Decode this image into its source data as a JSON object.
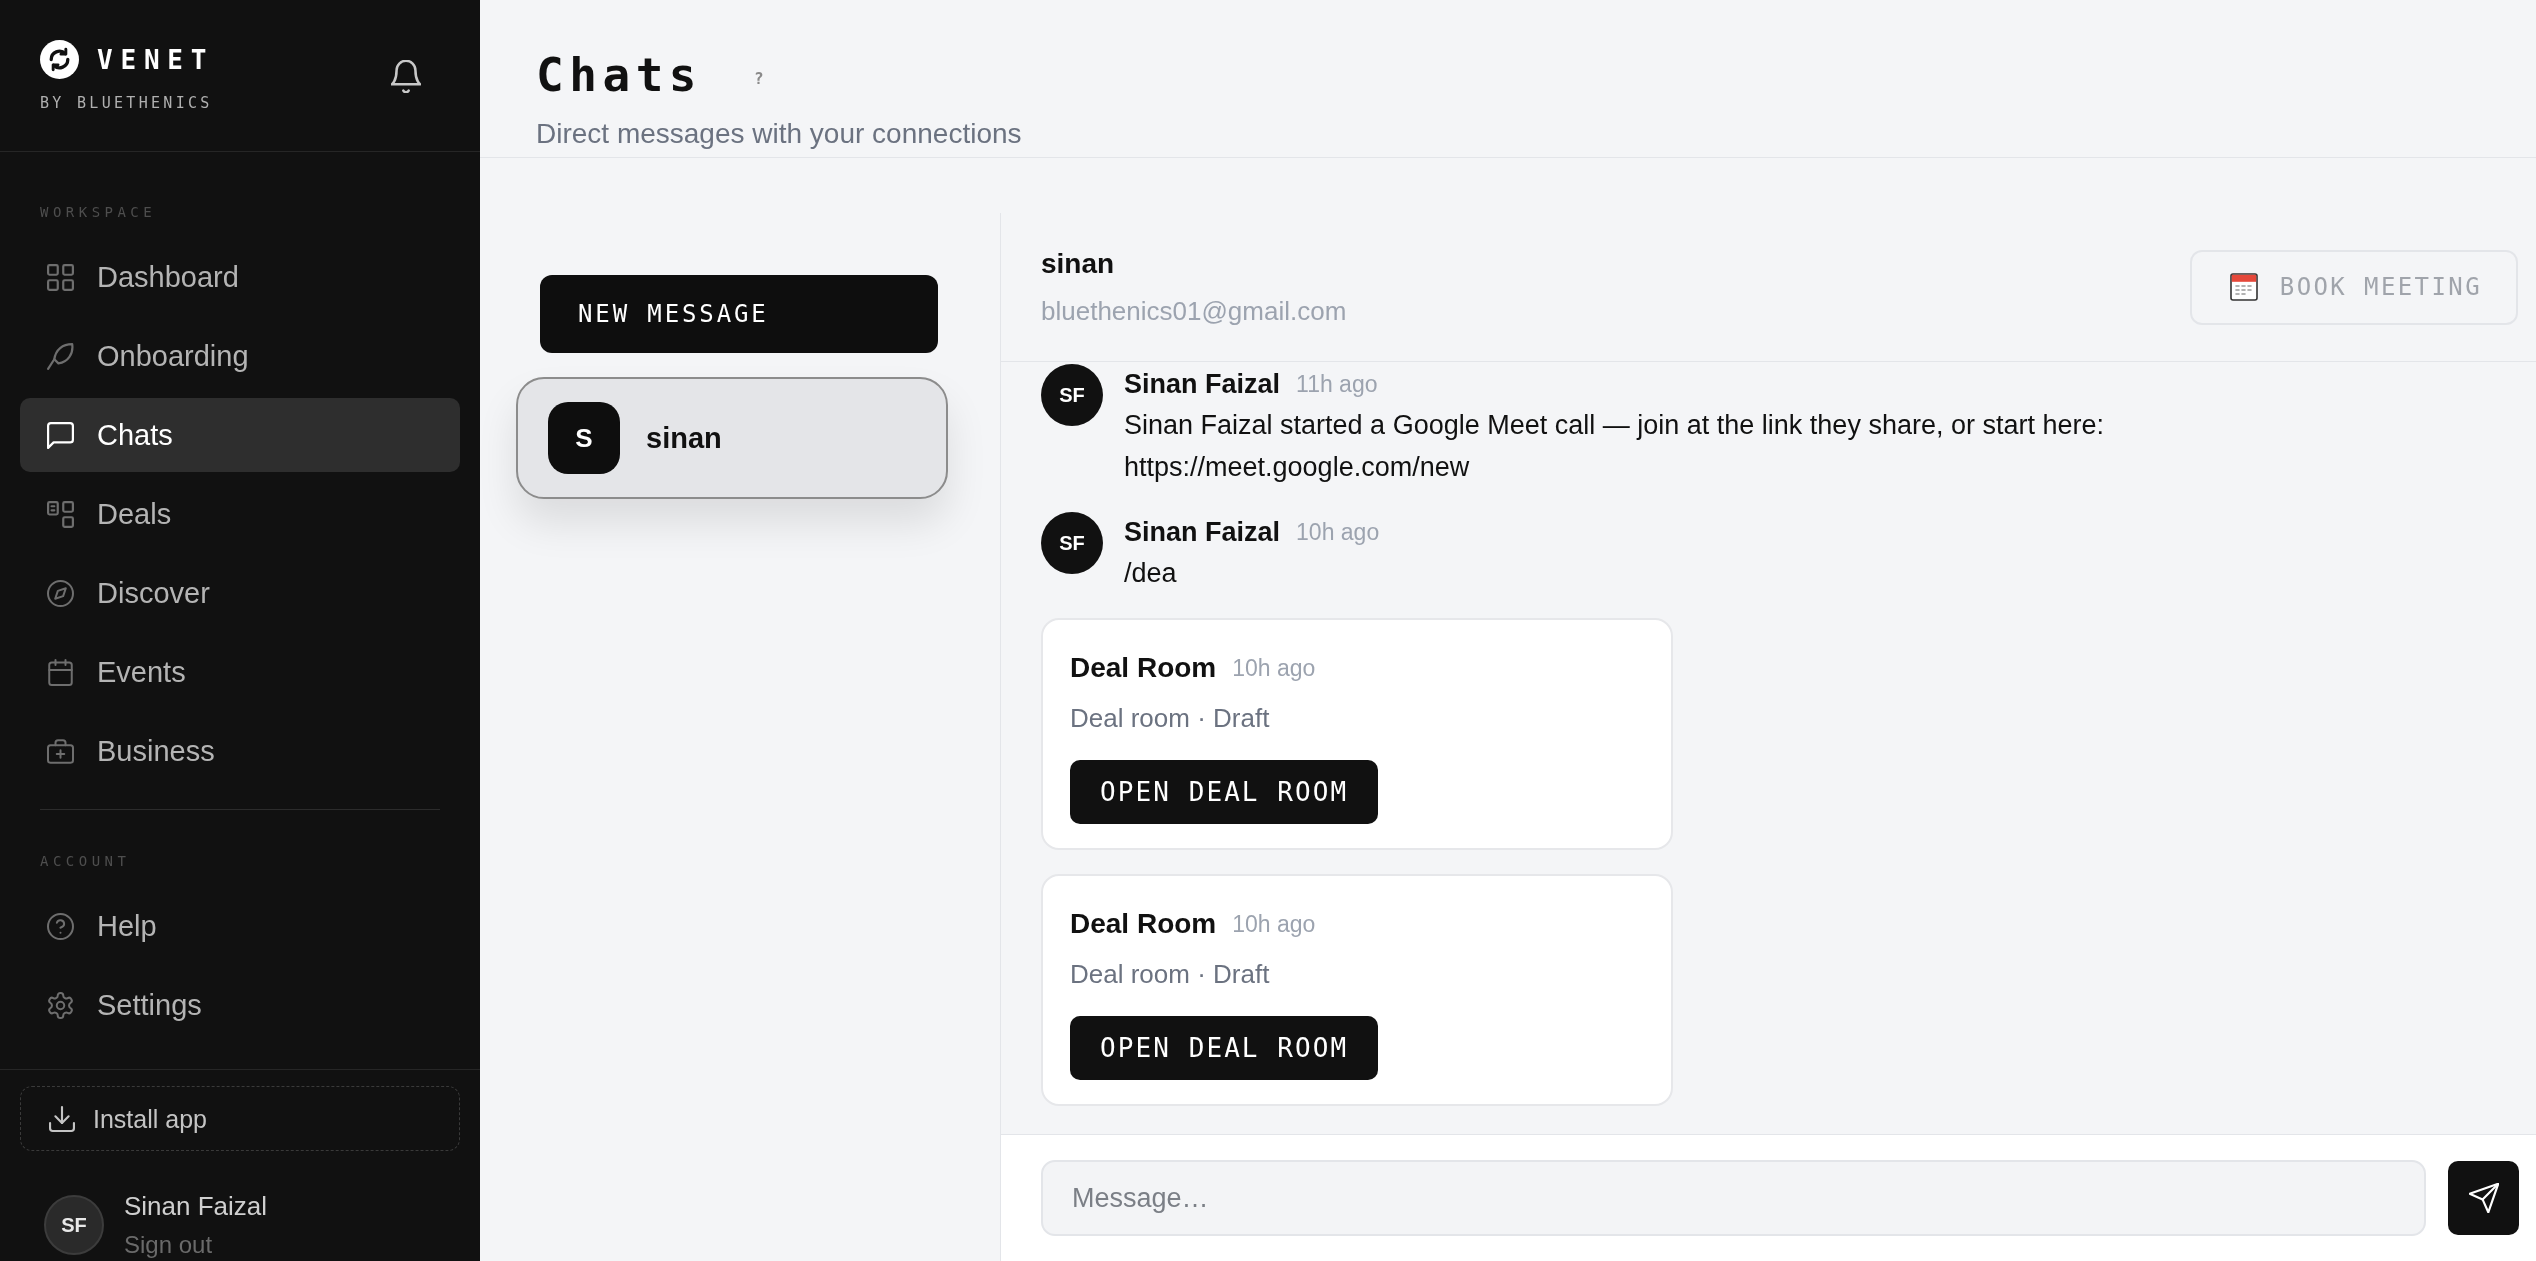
{
  "sidebar": {
    "brand": {
      "name": "VENET",
      "tagline": "BY BLUETHENICS"
    },
    "sections": [
      {
        "title": "WORKSPACE",
        "items": [
          {
            "label": "Dashboard",
            "selected": false
          },
          {
            "label": "Onboarding",
            "selected": false
          },
          {
            "label": "Chats",
            "selected": true
          },
          {
            "label": "Deals",
            "selected": false
          },
          {
            "label": "Discover",
            "selected": false
          },
          {
            "label": "Events",
            "selected": false
          },
          {
            "label": "Business",
            "selected": false
          }
        ]
      },
      {
        "title": "ACCOUNT",
        "items": [
          {
            "label": "Help",
            "selected": false
          },
          {
            "label": "Settings",
            "selected": false
          }
        ]
      }
    ],
    "install_button": "Install app",
    "user": {
      "initials": "SF",
      "name": "Sinan Faizal",
      "action": "Sign out"
    }
  },
  "header": {
    "title": "Chats",
    "help": "?",
    "subtitle": "Direct messages with your connections"
  },
  "chat_list": {
    "new_button": "NEW MESSAGE",
    "contacts": [
      {
        "initial": "S",
        "name": "sinan",
        "selected": true
      }
    ]
  },
  "conversation": {
    "name": "sinan",
    "email": "bluethenics01@gmail.com",
    "book_button": "BOOK MEETING",
    "messages": [
      {
        "kind": "text",
        "initials": "SF",
        "author": "Sinan Faizal",
        "time": "11h ago",
        "text": "Sinan Faizal started a Google Meet call — join at the link they share, or start here:\nhttps://meet.google.com/new"
      },
      {
        "kind": "text",
        "initials": "SF",
        "author": "Sinan Faizal",
        "time": "10h ago",
        "text": "/dea"
      },
      {
        "kind": "card",
        "title": "Deal Room",
        "time": "10h ago",
        "subtitle": "Deal room · Draft",
        "button": "OPEN DEAL ROOM"
      },
      {
        "kind": "card",
        "title": "Deal Room",
        "time": "10h ago",
        "subtitle": "Deal room · Draft",
        "button": "OPEN DEAL ROOM"
      }
    ],
    "composer": {
      "placeholder": "Message…"
    }
  }
}
